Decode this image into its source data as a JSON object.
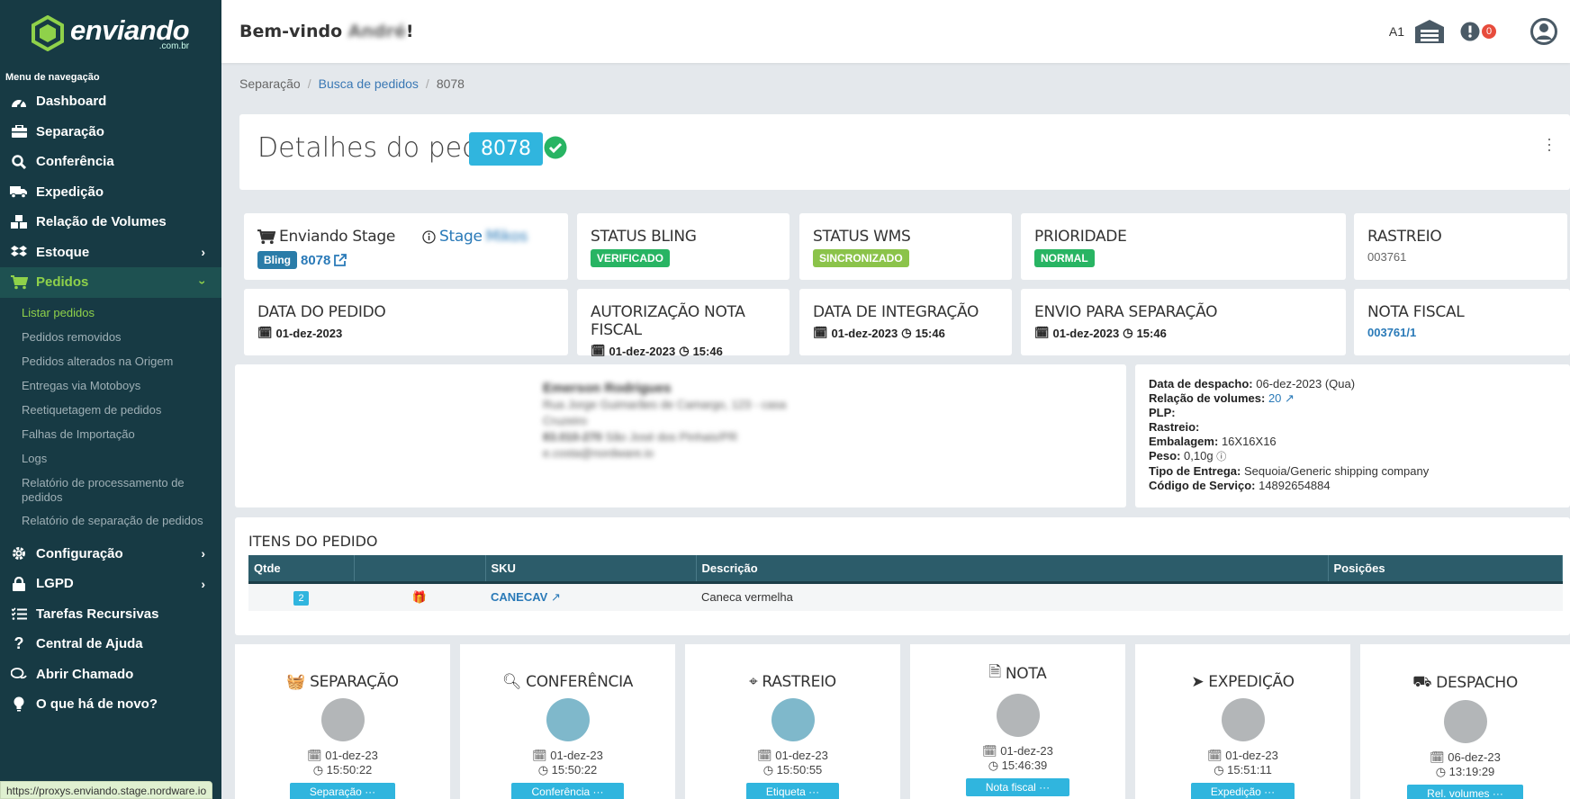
{
  "brand": {
    "name": "enviando",
    "domain": ".com.br"
  },
  "sidebar": {
    "heading": "Menu de navegação",
    "items": [
      {
        "label": "Dashboard",
        "icon": "dashboard-icon"
      },
      {
        "label": "Separação",
        "icon": "briefcase-icon"
      },
      {
        "label": "Conferência",
        "icon": "search-icon"
      },
      {
        "label": "Expedição",
        "icon": "truck-icon"
      },
      {
        "label": "Relação de Volumes",
        "icon": "cubes-icon"
      },
      {
        "label": "Estoque",
        "icon": "dropbox-icon"
      },
      {
        "label": "Pedidos",
        "icon": "cart-icon"
      },
      {
        "label": "Configuração",
        "icon": "gear-icon"
      },
      {
        "label": "LGPD",
        "icon": "lock-icon"
      },
      {
        "label": "Tarefas Recursivas",
        "icon": "tasks-icon"
      },
      {
        "label": "Central de Ajuda",
        "icon": "question-icon"
      },
      {
        "label": "Abrir Chamado",
        "icon": "comments-icon"
      },
      {
        "label": "O que há de novo?",
        "icon": "lightbulb-icon"
      }
    ],
    "pedidos_sub": [
      "Listar pedidos",
      "Pedidos removidos",
      "Pedidos alterados na Origem",
      "Entregas via Motoboys",
      "Reetiquetagem de pedidos",
      "Falhas de Importação",
      "Logs",
      "Relatório de processamento de pedidos",
      "Relatório de separação de pedidos"
    ]
  },
  "status_url": "https://proxys.enviando.stage.nordware.io",
  "topbar": {
    "welcome_prefix": "Bem-vindo ",
    "user_name": "André",
    "welcome_suffix": "!",
    "account": "A1",
    "alert_count": "0"
  },
  "breadcrumb": {
    "items": [
      "Separação",
      "Busca de pedidos",
      "8078"
    ]
  },
  "header": {
    "title": "Detalhes do pedido",
    "order_number": "8078"
  },
  "info_cards": {
    "store": {
      "name": "Enviando Stage",
      "stage_label": "Stage",
      "stage_name": "Mikos",
      "platform": "Bling",
      "order_ref": "8078"
    },
    "status_bling": {
      "label": "STATUS BLING",
      "value": "VERIFICADO"
    },
    "status_wms": {
      "label": "STATUS WMS",
      "value": "SINCRONIZADO"
    },
    "priority": {
      "label": "PRIORIDADE",
      "value": "NORMAL"
    },
    "tracking": {
      "label": "RASTREIO",
      "value": "003761"
    },
    "order_date": {
      "label": "DATA DO PEDIDO",
      "date": "01-dez-2023"
    },
    "invoice_auth": {
      "label": "AUTORIZAÇÃO NOTA FISCAL",
      "date": "01-dez-2023",
      "time": "15:46"
    },
    "integration": {
      "label": "DATA DE INTEGRAÇÃO",
      "date": "01-dez-2023",
      "time": "15:46"
    },
    "sent_separation": {
      "label": "ENVIO PARA SEPARAÇÃO",
      "date": "01-dez-2023",
      "time": "15:46"
    },
    "invoice": {
      "label": "NOTA FISCAL",
      "value": "003761/1"
    }
  },
  "address": {
    "name": "Emerson Rodrigues",
    "line1": "Rua Jorge Guimarães de Camargo, 123 - casa",
    "line2": "Cruzeiro",
    "line3_cep": "83.010-270",
    "line3_city": "São José dos Pinhais/PR",
    "email": "e.costa@nordware.io"
  },
  "dispatch": {
    "date_label": "Data de despacho:",
    "date_value": "06-dez-2023 (Qua)",
    "volumes_label": "Relação de volumes:",
    "volumes_value": "20",
    "plp_label": "PLP:",
    "tracking_label": "Rastreio:",
    "package_label": "Embalagem:",
    "package_value": "16X16X16",
    "weight_label": "Peso:",
    "weight_value": "0,10g",
    "delivery_label": "Tipo de Entrega:",
    "delivery_value": "Sequoia/Generic shipping company",
    "service_label": "Código de Serviço:",
    "service_value": "14892654884"
  },
  "items": {
    "title": "ITENS DO PEDIDO",
    "columns": [
      "Qtde",
      "",
      "SKU",
      "Descrição",
      "Posições"
    ],
    "rows": [
      {
        "qty": "2",
        "sku": "CANECAV",
        "description": "Caneca vermelha",
        "positions": ""
      }
    ]
  },
  "stages": [
    {
      "title": "SEPARAÇÃO",
      "icon": "basket-icon",
      "date": "01-dez-23",
      "time": "15:50:22",
      "button": "Separação ···",
      "color": "#b3b6b8"
    },
    {
      "title": "CONFERÊNCIA",
      "icon": "search-icon",
      "date": "01-dez-23",
      "time": "15:50:22",
      "button": "Conferência ···",
      "color": "#7fb8cb"
    },
    {
      "title": "RASTREIO",
      "icon": "crosshair-icon",
      "date": "01-dez-23",
      "time": "15:50:55",
      "button": "Etiqueta ···",
      "color": "#7fb8cb"
    },
    {
      "title": "NOTA",
      "icon": "file-icon",
      "date": "01-dez-23",
      "time": "15:46:39",
      "button": "Nota fiscal ···",
      "color": "#b3b6b8"
    },
    {
      "title": "EXPEDIÇÃO",
      "icon": "send-icon",
      "date": "01-dez-23",
      "time": "15:51:11",
      "button": "Expedição ···",
      "color": "#b3b6b8"
    },
    {
      "title": "DESPACHO",
      "icon": "truck-icon",
      "date": "06-dez-23",
      "time": "13:19:29",
      "button": "Rel. volumes ···",
      "color": "#b3b6b8"
    }
  ],
  "colors": {
    "sidebar_bg": "#173a44",
    "accent": "#30b5de",
    "active_green": "#8fd14a",
    "success": "#28b463"
  }
}
